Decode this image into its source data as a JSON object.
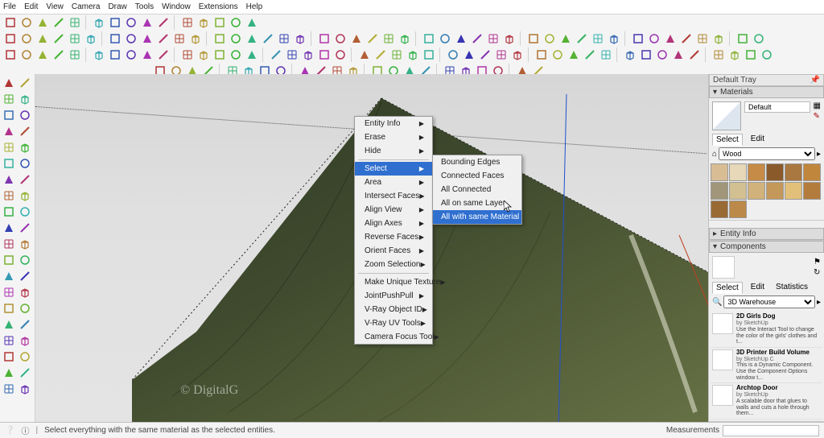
{
  "menubar": [
    "File",
    "Edit",
    "View",
    "Camera",
    "Draw",
    "Tools",
    "Window",
    "Extensions",
    "Help"
  ],
  "context_menu": {
    "groups": [
      [
        "Entity Info",
        "Erase",
        "Hide"
      ],
      [
        {
          "label": "Select",
          "sub": true,
          "hl": true
        },
        {
          "label": "Area",
          "sub": true
        },
        {
          "label": "Intersect Faces",
          "sub": true
        },
        "Align View",
        "Align Axes",
        "Reverse Faces",
        "Orient Faces",
        "Zoom Selection"
      ],
      [
        "Make Unique Texture",
        {
          "label": "JointPushPull",
          "sub": true
        },
        {
          "label": "V-Ray Object ID",
          "sub": true
        },
        {
          "label": "V-Ray UV Tools",
          "sub": true
        },
        "Camera Focus Tool"
      ]
    ]
  },
  "submenu": {
    "items": [
      "Bounding Edges",
      "Connected Faces",
      "All Connected",
      "All on same Layer",
      "All with same Material"
    ],
    "hl_index": 4
  },
  "tray": {
    "title": "Default Tray",
    "materials": {
      "header": "Materials",
      "current": "Default",
      "tabs": [
        "Select",
        "Edit"
      ],
      "dropdown": "Wood",
      "swatches": [
        "#d8bd94",
        "#e6d8b8",
        "#c68b46",
        "#8a5a2b",
        "#a97840",
        "#c0863c",
        "#a1967a",
        "#d2c092",
        "#d1b27a",
        "#c49858",
        "#e2c07a",
        "#b47c3c",
        "#9a6a34",
        "#bb8a4a"
      ]
    },
    "entity_info": "Entity Info",
    "components": {
      "header": "Components",
      "tabs": [
        "Select",
        "Edit",
        "Statistics"
      ],
      "search": "3D Warehouse",
      "items": [
        {
          "name": "2D Girls Dog",
          "by": "by SketchUp",
          "desc": "Use the Interact Tool to change the color of the girls' clothes and t..."
        },
        {
          "name": "3D Printer Build Volume",
          "by": "by SketchUp C",
          "desc": "This is a Dynamic Component. Use the Component Options window t..."
        },
        {
          "name": "Archtop Door",
          "by": "by SketchUp",
          "desc": "A scalable door that glues to walls and cuts a hole through them..."
        }
      ]
    }
  },
  "status": {
    "hint": "Select everything with the same material as the selected entities.",
    "meas_label": "Measurements"
  },
  "watermark": "© DigitalG"
}
